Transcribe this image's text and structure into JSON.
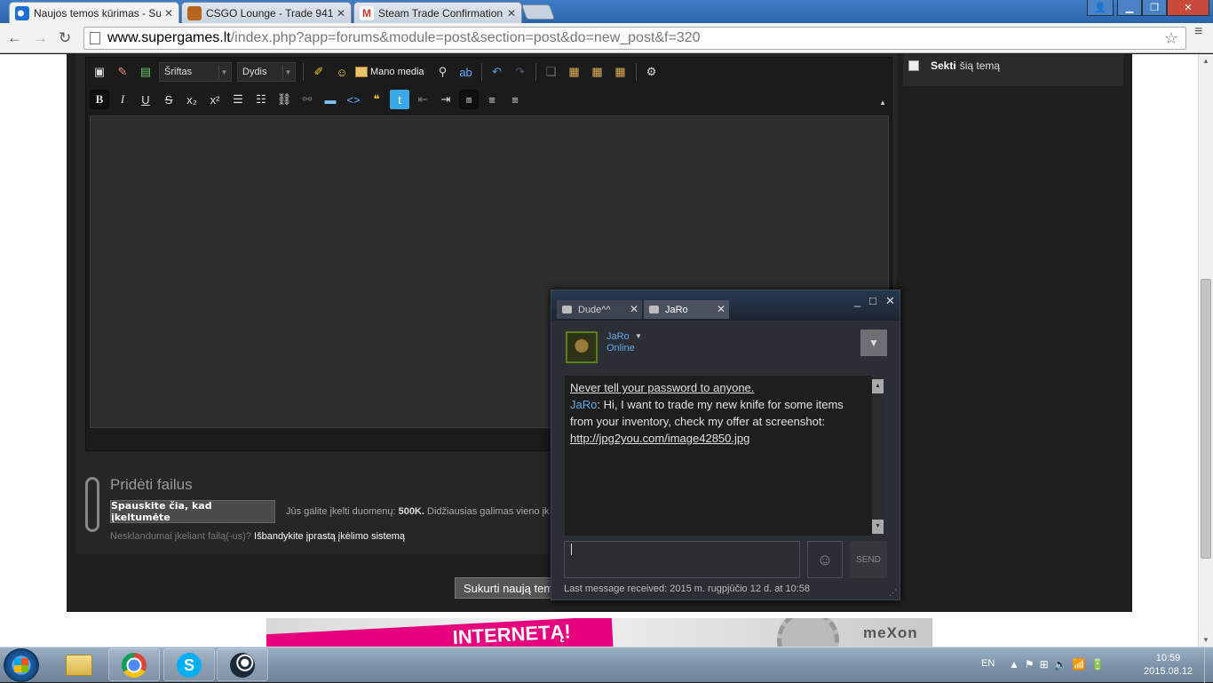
{
  "browser": {
    "tabs": [
      {
        "title": "Naujos temos kūrimas - Su",
        "active": true
      },
      {
        "title": "CSGO Lounge - Trade 941",
        "active": false
      },
      {
        "title": "Steam Trade Confirmation",
        "active": false
      }
    ],
    "url_host": "www.supergames.lt",
    "url_path": "/index.php?app=forums&module=post&section=post&do=new_post&f=320"
  },
  "editor": {
    "font_combo": "Šriftas",
    "size_combo": "Dydis",
    "mano_media": "Mano media"
  },
  "attach": {
    "title": "Pridėti failus",
    "upload_button": "Spauskite čia, kad įkeltumėte",
    "info_prefix": "Jūs galite įkelti duomenų:",
    "info_size": "500K.",
    "info_rest": "Didžiausias galimas vieno įk",
    "note_prefix": "Nesklandumai įkeliant failą(-us)?",
    "note_link": "Išbandykite įprastą įkėlimo sistemą"
  },
  "sidebar": {
    "follow_bold": "Sekti",
    "follow_rest": "šią temą"
  },
  "submit_label": "Sukurti naują temą",
  "ad": {
    "banner_text": "INTERNETĄ!",
    "logo": "meXon"
  },
  "chat": {
    "tabs": [
      {
        "name": "Dude^^"
      },
      {
        "name": "JaRo"
      }
    ],
    "friend_name": "JaRo",
    "friend_status": "Online",
    "warning": "Never tell your password to anyone.",
    "msg_sender": "JaRo",
    "msg_text": ": Hi, I want to trade my new knife  for some items from your inventory, check my offer at screenshot:",
    "msg_link": "http://jpg2you.com/image42850.jpg",
    "send_label": "SEND",
    "footer": "Last message received: 2015 m. rugpjūčio 12 d. at 10:58"
  },
  "taskbar": {
    "lang": "EN",
    "time": "10:59",
    "date": "2015.08.12"
  }
}
